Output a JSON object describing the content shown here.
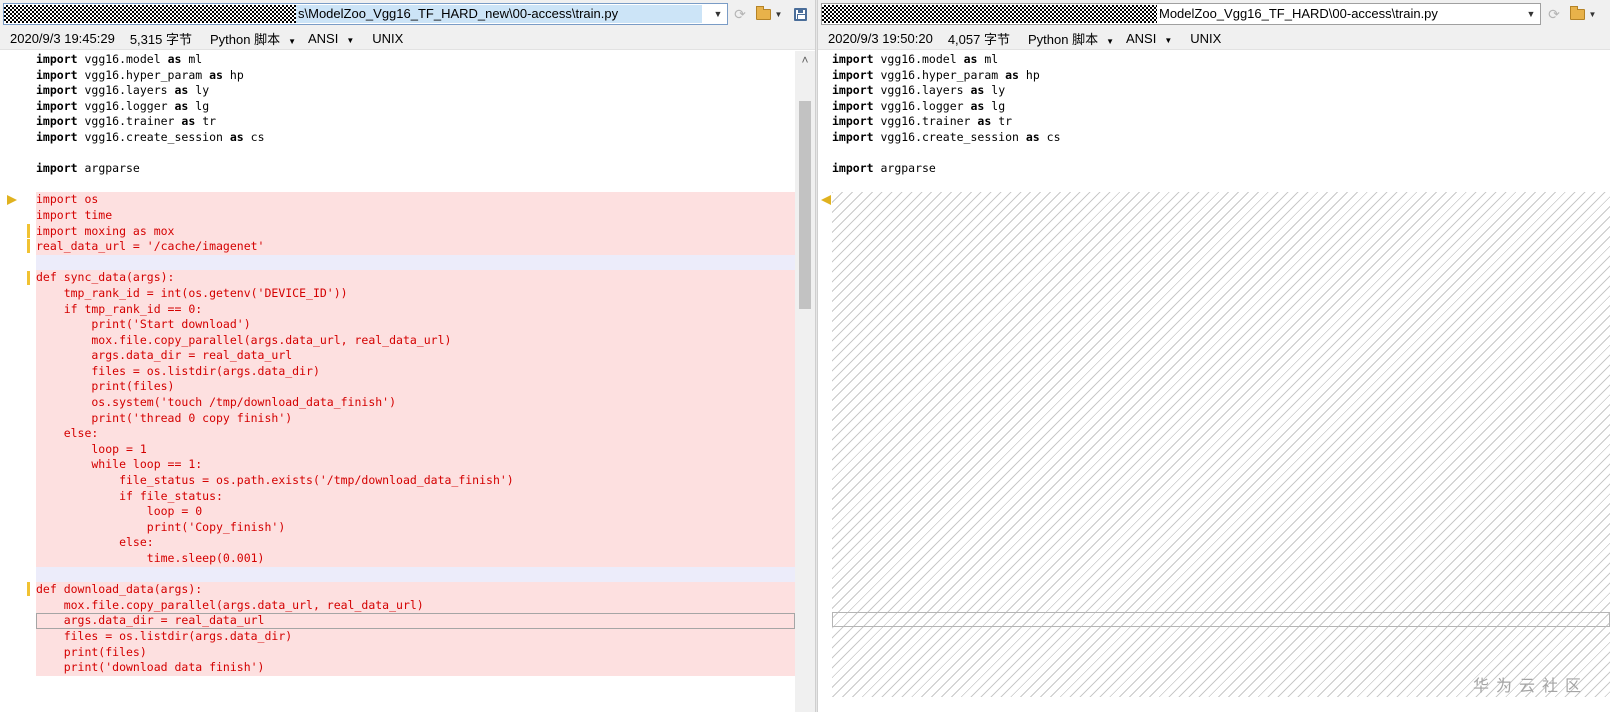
{
  "left": {
    "path_text": "s\\ModelZoo_Vgg16_TF_HARD_new\\00-access\\train.py",
    "datetime": "2020/9/3 19:45:29",
    "size": "5,315 字节",
    "language": "Python 脚本",
    "encoding": "ANSI",
    "eol": "UNIX"
  },
  "right": {
    "path_text": "ModelZoo_Vgg16_TF_HARD\\00-access\\train.py",
    "datetime": "2020/9/3 19:50:20",
    "size": "4,057 字节",
    "language": "Python 脚本",
    "encoding": "ANSI",
    "eol": "UNIX"
  },
  "icons": {
    "dropdown": "chevron-down-icon",
    "refresh": "refresh-icon",
    "open_folder": "open-folder-icon",
    "save": "save-icon",
    "diff_arrow_right": "arrow-right-icon",
    "diff_arrow_left": "arrow-left-icon",
    "scroll_up": "scroll-up-icon"
  },
  "colors": {
    "diff_bg": "#fde0e0",
    "diff_text": "#d40000",
    "marker": "#f1c232",
    "selected_path_bg": "#cce4f7"
  },
  "scroll": {
    "up_arrow": "˄"
  },
  "left_code": [
    {
      "text": "import vgg16.model as ml",
      "type": "normal"
    },
    {
      "text": "import vgg16.hyper_param as hp",
      "type": "normal"
    },
    {
      "text": "import vgg16.layers as ly",
      "type": "normal"
    },
    {
      "text": "import vgg16.logger as lg",
      "type": "normal"
    },
    {
      "text": "import vgg16.trainer as tr",
      "type": "normal"
    },
    {
      "text": "import vgg16.create_session as cs",
      "type": "normal"
    },
    {
      "text": "",
      "type": "normal"
    },
    {
      "text": "import argparse",
      "type": "normal"
    },
    {
      "text": "",
      "type": "normal"
    },
    {
      "text": "import os",
      "type": "diff"
    },
    {
      "text": "import time",
      "type": "diff"
    },
    {
      "text": "import moxing as mox",
      "type": "diff"
    },
    {
      "text": "real_data_url = '/cache/imagenet'",
      "type": "diff"
    },
    {
      "text": "",
      "type": "sep"
    },
    {
      "text": "def sync_data(args):",
      "type": "diff"
    },
    {
      "text": "    tmp_rank_id = int(os.getenv('DEVICE_ID'))",
      "type": "diff"
    },
    {
      "text": "    if tmp_rank_id == 0:",
      "type": "diff"
    },
    {
      "text": "        print('Start download')",
      "type": "diff"
    },
    {
      "text": "        mox.file.copy_parallel(args.data_url, real_data_url)",
      "type": "diff"
    },
    {
      "text": "        args.data_dir = real_data_url",
      "type": "diff"
    },
    {
      "text": "        files = os.listdir(args.data_dir)",
      "type": "diff"
    },
    {
      "text": "        print(files)",
      "type": "diff"
    },
    {
      "text": "        os.system('touch /tmp/download_data_finish')",
      "type": "diff"
    },
    {
      "text": "        print('thread 0 copy finish')",
      "type": "diff"
    },
    {
      "text": "    else:",
      "type": "diff"
    },
    {
      "text": "        loop = 1",
      "type": "diff"
    },
    {
      "text": "        while loop == 1:",
      "type": "diff"
    },
    {
      "text": "            file_status = os.path.exists('/tmp/download_data_finish')",
      "type": "diff"
    },
    {
      "text": "            if file_status:",
      "type": "diff"
    },
    {
      "text": "                loop = 0",
      "type": "diff"
    },
    {
      "text": "                print('Copy_finish')",
      "type": "diff"
    },
    {
      "text": "            else:",
      "type": "diff"
    },
    {
      "text": "                time.sleep(0.001)",
      "type": "diff"
    },
    {
      "text": "",
      "type": "sep"
    },
    {
      "text": "def download_data(args):",
      "type": "diff"
    },
    {
      "text": "    mox.file.copy_parallel(args.data_url, real_data_url)",
      "type": "diff"
    },
    {
      "text": "    args.data_dir = real_data_url",
      "type": "diff-caret"
    },
    {
      "text": "    files = os.listdir(args.data_dir)",
      "type": "diff"
    },
    {
      "text": "    print(files)",
      "type": "diff"
    },
    {
      "text": "    print('download data finish')",
      "type": "diff"
    }
  ],
  "right_code": [
    {
      "text": "import vgg16.model as ml",
      "type": "normal"
    },
    {
      "text": "import vgg16.hyper_param as hp",
      "type": "normal"
    },
    {
      "text": "import vgg16.layers as ly",
      "type": "normal"
    },
    {
      "text": "import vgg16.logger as lg",
      "type": "normal"
    },
    {
      "text": "import vgg16.trainer as tr",
      "type": "normal"
    },
    {
      "text": "import vgg16.create_session as cs",
      "type": "normal"
    },
    {
      "text": "",
      "type": "normal"
    },
    {
      "text": "import argparse",
      "type": "normal"
    }
  ],
  "watermark": "华为云社区"
}
